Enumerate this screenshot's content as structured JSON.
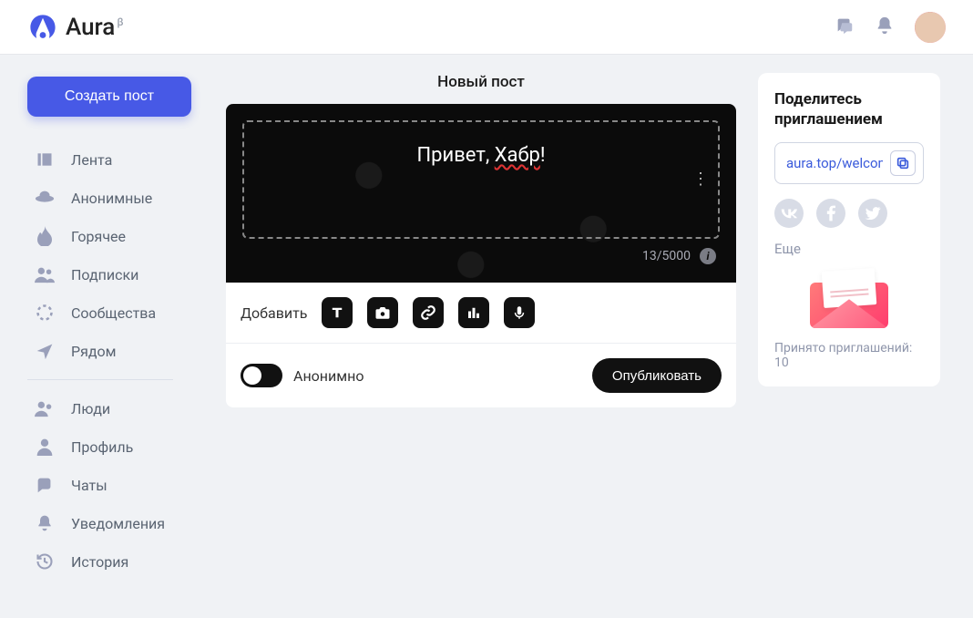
{
  "app": {
    "name": "Aura",
    "beta": "β"
  },
  "header": {
    "avatar": "user-avatar"
  },
  "sidebar": {
    "create_label": "Создать пост",
    "items": [
      {
        "icon": "feed-icon",
        "label": "Лента"
      },
      {
        "icon": "ufo-icon",
        "label": "Анонимные"
      },
      {
        "icon": "flame-icon",
        "label": "Горячее"
      },
      {
        "icon": "people-icon",
        "label": "Подписки"
      },
      {
        "icon": "circle-dots-icon",
        "label": "Сообщества"
      },
      {
        "icon": "location-arrow-icon",
        "label": "Рядом"
      }
    ],
    "items2": [
      {
        "icon": "users-icon",
        "label": "Люди"
      },
      {
        "icon": "person-icon",
        "label": "Профиль"
      },
      {
        "icon": "chat-icon",
        "label": "Чаты"
      },
      {
        "icon": "bell-icon",
        "label": "Уведомления"
      },
      {
        "icon": "history-icon",
        "label": "История"
      }
    ]
  },
  "main": {
    "title": "Новый пост",
    "editor_text_prefix": "Привет, ",
    "editor_text_underlined": "Хабр",
    "editor_text_suffix": "!",
    "char_count": "13/5000",
    "add_label": "Добавить",
    "anon_label": "Анонимно",
    "anon_on": false,
    "publish_label": "Опубликовать"
  },
  "invite": {
    "title": "Поделитесь приглашением",
    "link": "aura.top/welcome/a",
    "more": "Еще",
    "accepted_prefix": "Принято приглашений: ",
    "accepted_count": "10"
  }
}
